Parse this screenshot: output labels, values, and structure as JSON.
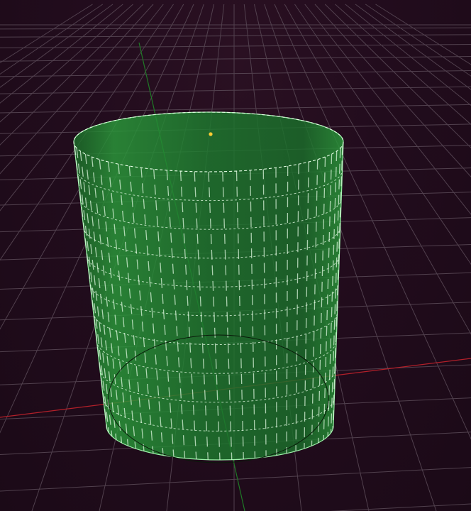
{
  "viewport": {
    "background": "#1f0d1a",
    "grid_color": "#5a4a57",
    "x_axis_color": "#b3202a",
    "y_axis_color": "#1f7a26"
  },
  "object": {
    "shape": "cylinder",
    "fill": "#1f7d30",
    "edge_color": "#e8ffe8",
    "pivot_color": "#ffcc33"
  }
}
